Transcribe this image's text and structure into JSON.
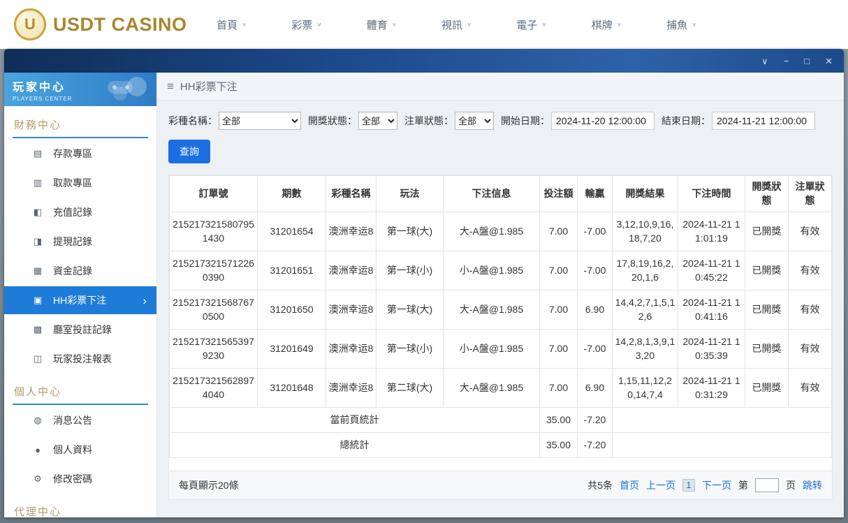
{
  "top_nav": {
    "logo_letter": "U",
    "brand": "USDT CASINO",
    "items": [
      "首頁",
      "彩票",
      "體育",
      "視訊",
      "電子",
      "棋牌",
      "捕魚"
    ]
  },
  "window_controls": [
    "chevron-down",
    "minimize",
    "maximize",
    "close"
  ],
  "sidebar": {
    "title": "玩家中心",
    "subtitle": "PLAYERS CENTER",
    "sections": [
      {
        "label": "財務中心",
        "items": [
          {
            "label": "存款專區",
            "icon": "deposit-icon"
          },
          {
            "label": "取款專區",
            "icon": "withdraw-icon"
          },
          {
            "label": "充值記錄",
            "icon": "recharge-record-icon"
          },
          {
            "label": "提現記錄",
            "icon": "withdraw-record-icon"
          },
          {
            "label": "資金記錄",
            "icon": "funds-record-icon"
          },
          {
            "label": "HH彩票下注",
            "icon": "lottery-bet-icon",
            "active": true
          },
          {
            "label": "廳室投註記錄",
            "icon": "room-bet-record-icon"
          },
          {
            "label": "玩家投注報表",
            "icon": "player-report-icon"
          }
        ]
      },
      {
        "label": "個人中心",
        "items": [
          {
            "label": "消息公告",
            "icon": "announcement-icon"
          },
          {
            "label": "個人資料",
            "icon": "profile-icon"
          },
          {
            "label": "修改密碼",
            "icon": "password-icon"
          }
        ]
      },
      {
        "label": "代理中心",
        "items": []
      }
    ]
  },
  "breadcrumb": {
    "title": "HH彩票下注"
  },
  "filters": {
    "lottery_label": "彩種名稱：",
    "lottery_value": "全部",
    "draw_status_label": "開獎狀態：",
    "draw_status_value": "全部",
    "order_status_label": "注單狀態：",
    "order_status_value": "全部",
    "start_label": "開始日期：",
    "start_value": "2024-11-20 12:00:00",
    "end_label": "結束日期：",
    "end_value": "2024-11-21 12:00:00",
    "search_button": "查詢"
  },
  "table": {
    "headers": [
      "訂單號",
      "期數",
      "彩種名稱",
      "玩法",
      "下注信息",
      "投注額",
      "輸贏",
      "開獎結果",
      "下注時間",
      "開獎狀態",
      "注單狀態"
    ],
    "rows": [
      [
        "2152173215807951430",
        "31201654",
        "澳洲幸运8",
        "第一球(大)",
        "大-A盤@1.985",
        "7.00",
        "-7.00",
        "3,12,10,9,16,18,7,20",
        "2024-11-21 11:01:19",
        "已開獎",
        "有效"
      ],
      [
        "2152173215712260390",
        "31201651",
        "澳洲幸运8",
        "第一球(小)",
        "小-A盤@1.985",
        "7.00",
        "-7.00",
        "17,8,19,16,2,20,1,6",
        "2024-11-21 10:45:22",
        "已開獎",
        "有效"
      ],
      [
        "2152173215687670500",
        "31201650",
        "澳洲幸运8",
        "第一球(大)",
        "大-A盤@1.985",
        "7.00",
        "6.90",
        "14,4,2,7,1,5,12,6",
        "2024-11-21 10:41:16",
        "已開獎",
        "有效"
      ],
      [
        "2152173215653979230",
        "31201649",
        "澳洲幸运8",
        "第一球(小)",
        "小-A盤@1.985",
        "7.00",
        "-7.00",
        "14,2,8,1,3,9,13,20",
        "2024-11-21 10:35:39",
        "已開獎",
        "有效"
      ],
      [
        "2152173215628974040",
        "31201648",
        "澳洲幸运8",
        "第二球(大)",
        "大-A盤@1.985",
        "7.00",
        "6.90",
        "1,15,11,12,20,14,7,4",
        "2024-11-21 10:31:29",
        "已開獎",
        "有效"
      ]
    ],
    "summary": [
      {
        "label": "當前頁統計",
        "amount": "35.00",
        "winloss": "-7.20"
      },
      {
        "label": "總統計",
        "amount": "35.00",
        "winloss": "-7.20"
      }
    ]
  },
  "footer": {
    "page_size_text": "每頁顯示20條",
    "total_text": "共5条",
    "first_label": "首页",
    "prev_label": "上一页",
    "current_page": "1",
    "next_label": "下一页",
    "goto_prefix": "第",
    "goto_suffix": "页",
    "goto_label": "跳转"
  },
  "colors": {
    "accent_blue": "#1b6fe0",
    "sidebar_active_blue": "#1f7bd8",
    "brand_gold": "#a8862f",
    "section_gold": "#b59a67",
    "titlebar_blue": "#1c4a8c"
  }
}
